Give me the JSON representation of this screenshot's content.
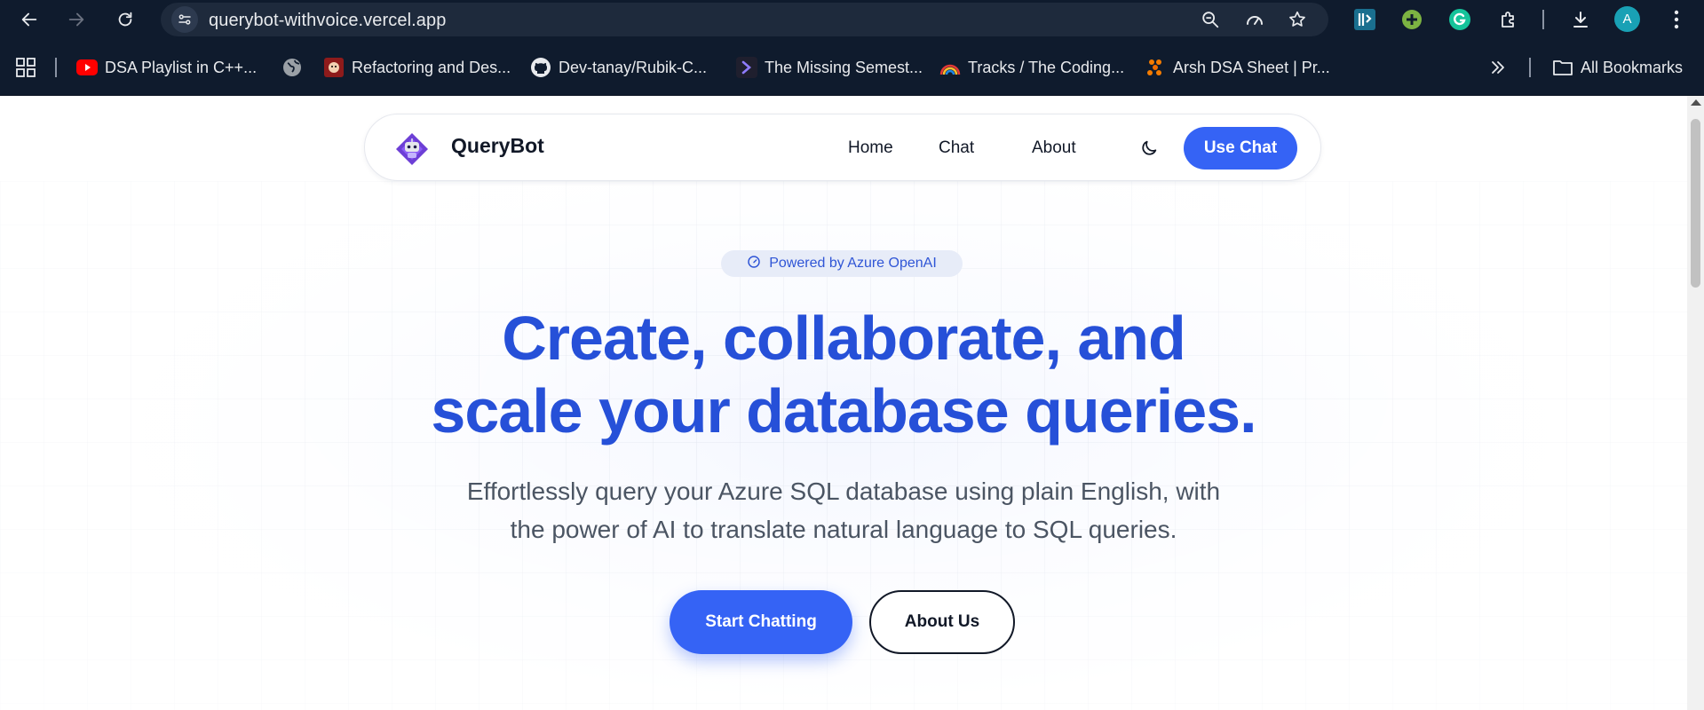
{
  "browser": {
    "url": "querybot-withvoice.vercel.app",
    "avatar_letter": "A",
    "icons": [
      "back-icon",
      "forward-icon",
      "reload-icon",
      "site-info-icon",
      "zoom-icon",
      "performance-icon",
      "star-icon",
      "extension-rise-icon",
      "extension-plus-icon",
      "extension-grammarly-icon",
      "extensions-puzzle-icon",
      "download-icon",
      "menu-kebab-icon"
    ]
  },
  "bookmarks": {
    "items": [
      {
        "label": "DSA Playlist in C++...",
        "icon": "youtube-icon"
      },
      {
        "label": "",
        "icon": "globe-icon"
      },
      {
        "label": "Refactoring and Des...",
        "icon": "refactoring-guru-icon"
      },
      {
        "label": "Dev-tanay/Rubik-C...",
        "icon": "github-icon"
      },
      {
        "label": "The Missing Semest...",
        "icon": "chevron-prompt-icon"
      },
      {
        "label": "Tracks / The Coding...",
        "icon": "rainbow-icon"
      },
      {
        "label": "Arsh DSA Sheet | Pr...",
        "icon": "arsh-dsa-icon"
      }
    ],
    "all_bookmarks_label": "All Bookmarks"
  },
  "navbar": {
    "brand": "QueryBot",
    "links": [
      "Home",
      "Chat",
      "About"
    ],
    "cta": "Use Chat"
  },
  "hero": {
    "badge": "Powered by Azure OpenAI",
    "headline_line1": "Create, collaborate, and",
    "headline_line2": "scale your database queries.",
    "sub_line1": "Effortlessly query your Azure SQL database using plain English, with",
    "sub_line2": "the power of AI to translate natural language to SQL queries.",
    "primary_button": "Start Chatting",
    "secondary_button": "About Us"
  },
  "colors": {
    "chrome_bg": "#0f1b2d",
    "accent": "#3563f5",
    "headline": "#2650d8",
    "text": "#111827",
    "muted": "#4b5563"
  }
}
